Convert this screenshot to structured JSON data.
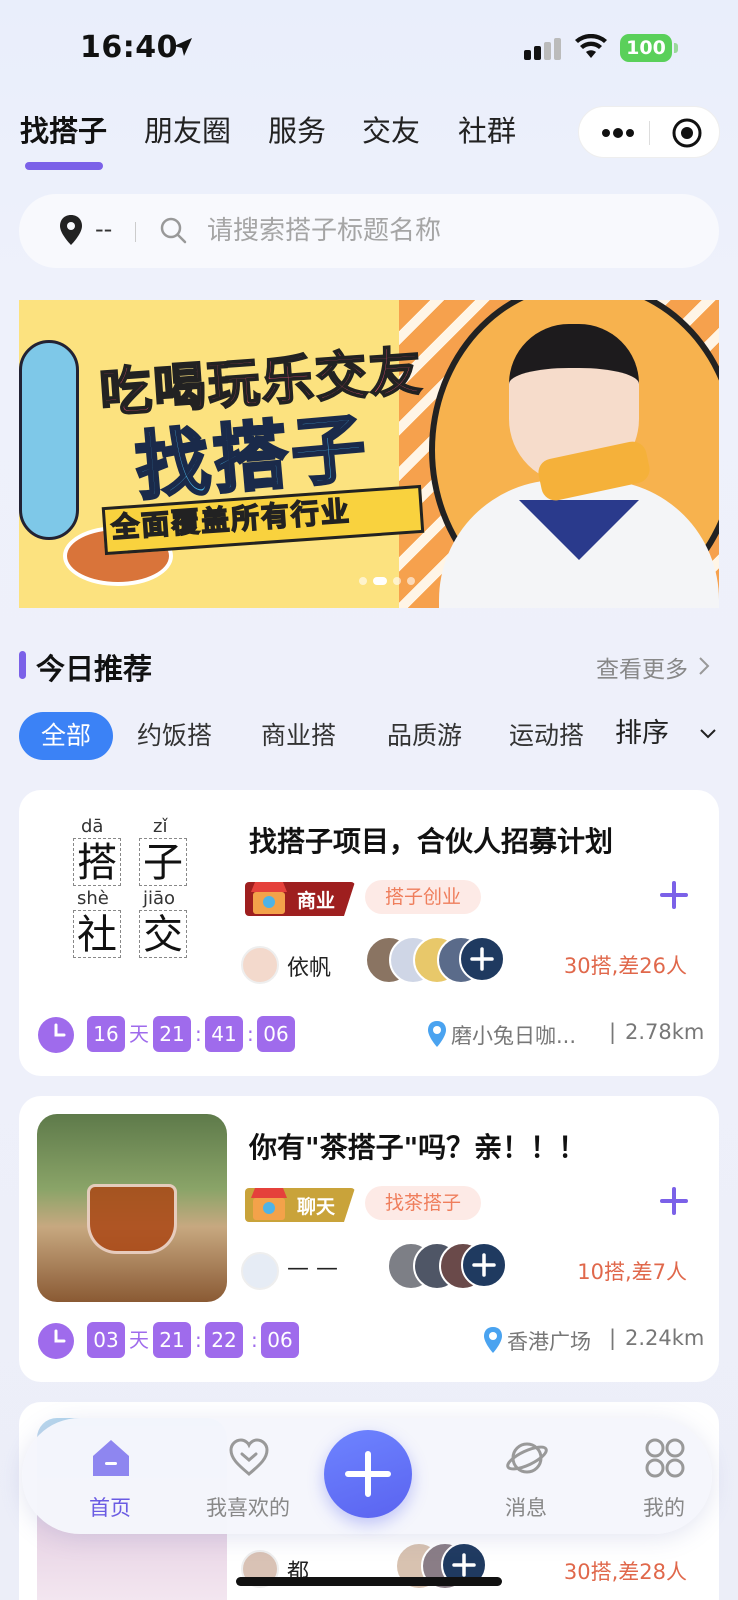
{
  "status_bar": {
    "time": "16:40",
    "battery": "100"
  },
  "top_tabs": [
    "找搭子",
    "朋友圈",
    "服务",
    "交友",
    "社群"
  ],
  "search": {
    "location": "--",
    "placeholder": "请搜索搭子标题名称"
  },
  "section": {
    "title": "今日推荐",
    "more": "查看更多"
  },
  "categories": [
    "全部",
    "约饭搭",
    "商业搭",
    "品质游",
    "运动搭"
  ],
  "sort_label": "排序",
  "cards": [
    {
      "title": "找搭子项目，合伙人招募计划",
      "type": "商业",
      "type_color": "#9e1f1f",
      "tag": "搭子创业",
      "user": "依帆",
      "count": "30搭,差26人",
      "countdown": {
        "days": "16",
        "day_unit": "天",
        "hours": "21",
        "minutes": "41",
        "seconds": "06"
      },
      "place": "磨小兔日咖...",
      "distance": "2.78km",
      "image": {
        "pinyin": [
          "dā",
          "zǐ",
          "shè",
          "jiāo"
        ],
        "chars": [
          "搭",
          "子",
          "社",
          "交"
        ]
      }
    },
    {
      "title": "你有\"茶搭子\"吗？亲！！！",
      "type": "聊天",
      "type_color": "#c9a33a",
      "tag": "找茶搭子",
      "user": "— —",
      "count": "10搭,差7人",
      "countdown": {
        "days": "03",
        "day_unit": "天",
        "hours": "21",
        "minutes": "22",
        "seconds": "06"
      },
      "place": "香港广场",
      "distance": "2.24km"
    },
    {
      "user": "都",
      "count": "30搭,差28人"
    }
  ],
  "tab_bar": [
    "首页",
    "我喜欢的",
    "消息",
    "我的"
  ],
  "colors": {
    "accent": "#7b61e8",
    "chip_active": "#3b82f6",
    "count": "#e0684b",
    "countdown": "#9f6bec"
  }
}
